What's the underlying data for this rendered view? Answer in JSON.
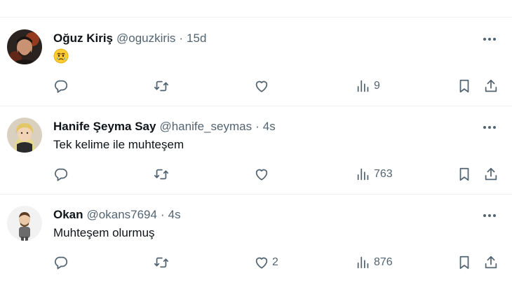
{
  "tweets": [
    {
      "name": "Oğuz Kiriş",
      "handle": "@oguzkiris",
      "separator": "·",
      "time": "15d",
      "text": "",
      "emoji": "face-holding-back-tears",
      "replies": "",
      "reposts": "",
      "likes": "",
      "views": "9"
    },
    {
      "name": "Hanife Şeyma Say",
      "handle": "@hanife_seymas",
      "separator": "·",
      "time": "4s",
      "text": "Tek kelime ile muhteşem",
      "replies": "",
      "reposts": "",
      "likes": "",
      "views": "763"
    },
    {
      "name": "Okan",
      "handle": "@okans7694",
      "separator": "·",
      "time": "4s",
      "text": "Muhteşem olurmuş",
      "replies": "",
      "reposts": "",
      "likes": "2",
      "views": "876"
    }
  ],
  "icons": {
    "reply": "reply-icon",
    "repost": "repost-icon",
    "like": "like-icon",
    "views": "views-icon",
    "bookmark": "bookmark-icon",
    "share": "share-icon",
    "more": "more-icon"
  },
  "colors": {
    "text": "#0f1419",
    "secondary": "#536471",
    "divider": "#eff3f4"
  }
}
